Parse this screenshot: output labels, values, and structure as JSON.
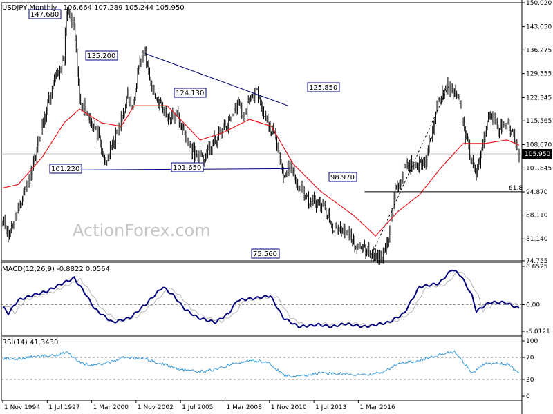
{
  "main_header": {
    "symbol_tf": "USDJPY,Monthly",
    "ohlc": "106.664 107.289 105.244 105.950"
  },
  "watermark": "ActionForex.com",
  "colors": {
    "candle": "#000000",
    "ma": "#e8151d",
    "trendline": "#00007a",
    "macd_line": "#00007a",
    "macd_signal": "#b3b3b3",
    "rsi": "#3399dd",
    "label_border": "#00007a",
    "current_box": "#000000"
  },
  "chart_data": [
    {
      "type": "candlestick",
      "title": "USDJPY,Monthly",
      "ylim": [
        74.75,
        150.02
      ],
      "y_ticks": [
        "150.020",
        "143.050",
        "136.275",
        "129.355",
        "122.345",
        "115.565",
        "108.670",
        "101.845",
        "94.870",
        "88.110",
        "81.140",
        "74.755"
      ],
      "x_ticks": [
        "1 Nov 1994",
        "1 Jul 1997",
        "1 Mar 2000",
        "1 Nov 2002",
        "1 Jul 2005",
        "1 Mar 2008",
        "1 Nov 2010",
        "1 Jul 2013",
        "1 Mar 2016"
      ],
      "current_price": "105.950",
      "annotations": [
        {
          "text": "147.680",
          "value": 147.68
        },
        {
          "text": "135.200",
          "value": 135.2
        },
        {
          "text": "124.130",
          "value": 124.13
        },
        {
          "text": "125.850",
          "value": 125.85
        },
        {
          "text": "101.220",
          "value": 101.22
        },
        {
          "text": "101.650",
          "value": 101.65
        },
        {
          "text": "98.970",
          "value": 98.97
        },
        {
          "text": "75.560",
          "value": 75.56
        }
      ],
      "fib_level": {
        "text": "61.8",
        "value": 94.9
      },
      "anchors": [
        [
          0,
          88
        ],
        [
          5,
          82
        ],
        [
          14,
          90
        ],
        [
          26,
          101
        ],
        [
          38,
          116
        ],
        [
          47,
          127
        ],
        [
          56,
          133
        ],
        [
          58,
          147.68
        ],
        [
          65,
          143
        ],
        [
          70,
          122
        ],
        [
          80,
          116
        ],
        [
          87,
          111
        ],
        [
          93,
          103
        ],
        [
          106,
          113
        ],
        [
          114,
          123
        ],
        [
          118,
          119
        ],
        [
          124,
          132
        ],
        [
          130,
          135.2
        ],
        [
          136,
          125
        ],
        [
          142,
          121
        ],
        [
          150,
          117
        ],
        [
          160,
          117
        ],
        [
          170,
          108
        ],
        [
          182,
          104
        ],
        [
          194,
          110
        ],
        [
          206,
          115
        ],
        [
          214,
          121
        ],
        [
          220,
          117
        ],
        [
          226,
          123
        ],
        [
          231,
          124.13
        ],
        [
          238,
          117
        ],
        [
          244,
          113
        ],
        [
          250,
          110
        ],
        [
          256,
          99
        ],
        [
          262,
          103
        ],
        [
          268,
          97
        ],
        [
          278,
          93
        ],
        [
          286,
          92
        ],
        [
          294,
          90
        ],
        [
          300,
          84
        ],
        [
          312,
          84
        ],
        [
          320,
          80
        ],
        [
          330,
          78
        ],
        [
          340,
          76
        ],
        [
          344,
          75.56
        ],
        [
          352,
          81
        ],
        [
          358,
          95
        ],
        [
          368,
          103
        ],
        [
          376,
          102
        ],
        [
          386,
          104
        ],
        [
          398,
          122
        ],
        [
          408,
          125.85
        ],
        [
          416,
          122
        ],
        [
          422,
          112
        ],
        [
          428,
          104
        ],
        [
          432,
          98.97
        ],
        [
          438,
          110
        ],
        [
          444,
          118
        ],
        [
          452,
          113
        ],
        [
          460,
          114
        ],
        [
          466,
          111
        ],
        [
          471,
          106.5
        ]
      ],
      "ma_anchors": [
        [
          0,
          96
        ],
        [
          14,
          97
        ],
        [
          36,
          105
        ],
        [
          56,
          115
        ],
        [
          70,
          119
        ],
        [
          90,
          115
        ],
        [
          108,
          114
        ],
        [
          120,
          120
        ],
        [
          150,
          120
        ],
        [
          180,
          110
        ],
        [
          200,
          112
        ],
        [
          225,
          116
        ],
        [
          245,
          114
        ],
        [
          265,
          103
        ],
        [
          290,
          95
        ],
        [
          320,
          88
        ],
        [
          340,
          82
        ],
        [
          360,
          89
        ],
        [
          380,
          94
        ],
        [
          400,
          102
        ],
        [
          420,
          109
        ],
        [
          440,
          109
        ],
        [
          460,
          110
        ],
        [
          471,
          108.5
        ]
      ],
      "n_bars": 472,
      "trendlines": [
        {
          "from": [
            130,
            135.2
          ],
          "to": [
            260,
            120
          ]
        },
        {
          "from": [
            60,
            101.22
          ],
          "to": [
            262,
            101.65
          ]
        },
        {
          "from": [
            335,
            75.56
          ],
          "to": [
            407,
            125.85
          ],
          "style": "dotted"
        }
      ]
    },
    {
      "type": "line",
      "title": "MACD(12,26,9) -0.8822 0.0564",
      "ylim": [
        -6.0121,
        8.6525
      ],
      "y_ticks": [
        "8.6525",
        "0.00",
        "-6.0121"
      ],
      "zero_line": true,
      "macd_anchors": [
        [
          0,
          -0.5
        ],
        [
          5,
          -2
        ],
        [
          14,
          1
        ],
        [
          26,
          2
        ],
        [
          40,
          3
        ],
        [
          56,
          5
        ],
        [
          65,
          6
        ],
        [
          74,
          3
        ],
        [
          84,
          -1
        ],
        [
          100,
          -4
        ],
        [
          116,
          -3
        ],
        [
          130,
          0
        ],
        [
          146,
          4
        ],
        [
          156,
          2
        ],
        [
          166,
          -1
        ],
        [
          178,
          -3
        ],
        [
          194,
          -4
        ],
        [
          206,
          -2
        ],
        [
          214,
          1
        ],
        [
          232,
          1.5
        ],
        [
          244,
          2
        ],
        [
          256,
          -3
        ],
        [
          270,
          -5
        ],
        [
          288,
          -4.5
        ],
        [
          300,
          -5
        ],
        [
          312,
          -4.3
        ],
        [
          330,
          -5
        ],
        [
          352,
          -4
        ],
        [
          366,
          -2
        ],
        [
          380,
          4
        ],
        [
          398,
          4.8
        ],
        [
          410,
          8
        ],
        [
          418,
          6.5
        ],
        [
          428,
          2
        ],
        [
          432,
          -1.5
        ],
        [
          444,
          0.5
        ],
        [
          458,
          0.5
        ],
        [
          471,
          -0.8822
        ]
      ],
      "signal_lag": 6
    },
    {
      "type": "line",
      "title": "RSI(14) 41.3430",
      "ylim": [
        0,
        100
      ],
      "y_ticks": [
        "100",
        "70",
        "30",
        "0"
      ],
      "levels": [
        70,
        30
      ],
      "rsi_anchors": [
        [
          0,
          68
        ],
        [
          14,
          67
        ],
        [
          30,
          72
        ],
        [
          48,
          74
        ],
        [
          58,
          80
        ],
        [
          70,
          62
        ],
        [
          80,
          55
        ],
        [
          96,
          60
        ],
        [
          110,
          70
        ],
        [
          128,
          68
        ],
        [
          146,
          58
        ],
        [
          162,
          48
        ],
        [
          178,
          44
        ],
        [
          194,
          48
        ],
        [
          210,
          58
        ],
        [
          226,
          64
        ],
        [
          242,
          62
        ],
        [
          256,
          38
        ],
        [
          270,
          35
        ],
        [
          290,
          42
        ],
        [
          310,
          40
        ],
        [
          330,
          38
        ],
        [
          346,
          42
        ],
        [
          360,
          58
        ],
        [
          380,
          65
        ],
        [
          404,
          78
        ],
        [
          412,
          80
        ],
        [
          422,
          57
        ],
        [
          428,
          40
        ],
        [
          440,
          60
        ],
        [
          460,
          58
        ],
        [
          471,
          41.343
        ]
      ]
    }
  ]
}
